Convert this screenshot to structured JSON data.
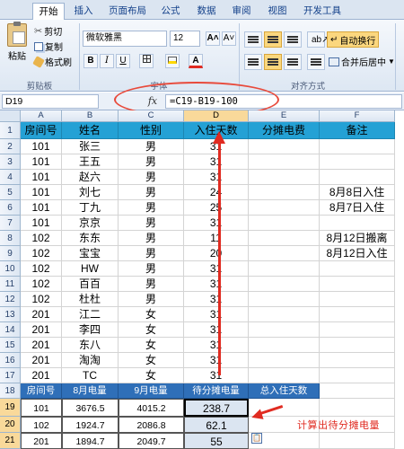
{
  "ribbon": {
    "tabs": [
      "开始",
      "插入",
      "页面布局",
      "公式",
      "数据",
      "审阅",
      "视图",
      "开发工具"
    ],
    "clipboard": {
      "paste": "粘贴",
      "cut": "剪切",
      "copy": "复制",
      "format_painter": "格式刷",
      "group": "剪贴板"
    },
    "font": {
      "name": "微软雅黑",
      "size": "12",
      "grow": "A˄",
      "shrink": "A˅",
      "bold": "B",
      "italic": "I",
      "underline": "U",
      "group": "字体"
    },
    "align": {
      "wrap": "自动换行",
      "merge": "合并后居中",
      "group": "对齐方式"
    }
  },
  "formula_bar": {
    "name_box": "D19",
    "fx": "fx",
    "formula": "=C19-B19-100"
  },
  "columns": [
    "A",
    "B",
    "C",
    "D",
    "E",
    "F"
  ],
  "rows": [
    {
      "num": "1",
      "cells": [
        "房间号",
        "姓名",
        "性别",
        "入住天数",
        "分摊电费",
        "备注"
      ]
    },
    {
      "num": "2",
      "cells": [
        "101",
        "张三",
        "男",
        "31",
        "",
        ""
      ]
    },
    {
      "num": "3",
      "cells": [
        "101",
        "王五",
        "男",
        "31",
        "",
        ""
      ]
    },
    {
      "num": "4",
      "cells": [
        "101",
        "赵六",
        "男",
        "31",
        "",
        ""
      ]
    },
    {
      "num": "5",
      "cells": [
        "101",
        "刘七",
        "男",
        "24",
        "",
        "8月8日入住"
      ]
    },
    {
      "num": "6",
      "cells": [
        "101",
        "丁九",
        "男",
        "25",
        "",
        "8月7日入住"
      ]
    },
    {
      "num": "7",
      "cells": [
        "101",
        "京京",
        "男",
        "31",
        "",
        ""
      ]
    },
    {
      "num": "8",
      "cells": [
        "102",
        "东东",
        "男",
        "11",
        "",
        "8月12日搬离"
      ]
    },
    {
      "num": "9",
      "cells": [
        "102",
        "宝宝",
        "男",
        "20",
        "",
        "8月12日入住"
      ]
    },
    {
      "num": "10",
      "cells": [
        "102",
        "HW",
        "男",
        "31",
        "",
        ""
      ]
    },
    {
      "num": "11",
      "cells": [
        "102",
        "百百",
        "男",
        "31",
        "",
        ""
      ]
    },
    {
      "num": "12",
      "cells": [
        "102",
        "杜杜",
        "男",
        "31",
        "",
        ""
      ]
    },
    {
      "num": "13",
      "cells": [
        "201",
        "江二",
        "女",
        "31",
        "",
        ""
      ]
    },
    {
      "num": "14",
      "cells": [
        "201",
        "李四",
        "女",
        "31",
        "",
        ""
      ]
    },
    {
      "num": "15",
      "cells": [
        "201",
        "东八",
        "女",
        "31",
        "",
        ""
      ]
    },
    {
      "num": "16",
      "cells": [
        "201",
        "淘淘",
        "女",
        "31",
        "",
        ""
      ]
    },
    {
      "num": "17",
      "cells": [
        "201",
        "TC",
        "女",
        "31",
        "",
        ""
      ]
    },
    {
      "num": "18",
      "cells": [
        "房间号",
        "8月电量",
        "9月电量",
        "待分摊电量",
        "总入住天数",
        ""
      ]
    },
    {
      "num": "19",
      "cells": [
        "101",
        "3676.5",
        "4015.2",
        "238.7",
        "",
        ""
      ]
    },
    {
      "num": "20",
      "cells": [
        "102",
        "1924.7",
        "2086.8",
        "62.1",
        "",
        ""
      ]
    },
    {
      "num": "21",
      "cells": [
        "201",
        "1894.7",
        "2049.7",
        "55",
        "",
        ""
      ]
    }
  ],
  "annotation": "计算出待分摊电量",
  "colors": {
    "header_row1": "#24a1d5",
    "header_row18": "#2f6fb8",
    "annotation": "#e02b21",
    "selected_col": "#f9d99a"
  }
}
